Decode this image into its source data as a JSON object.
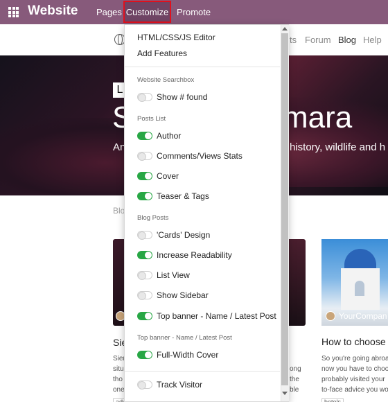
{
  "topbar": {
    "brand": "Website",
    "nav": {
      "pages": "Pages",
      "customize": "Customize",
      "promote": "Promote"
    }
  },
  "sitenav": {
    "items_partial": [
      "ts",
      "Forum",
      "Blog",
      "Help"
    ]
  },
  "hero": {
    "label_partial": "L",
    "title_left_partial": "S",
    "title_right_partial": "mara",
    "subtitle_left_partial": "An",
    "subtitle_right_partial": "history, wildlife and h"
  },
  "content": {
    "breadcrumb_partial": "Blo",
    "card1_title_partial": "Sie",
    "card1_lines": [
      "Sier",
      "situ",
      "tho",
      "one"
    ],
    "card2_lines": [
      "ong",
      "the",
      "ble"
    ],
    "card3_author_partial": "YourCompan",
    "card3_title_partial": "How to choose",
    "card3_lines": [
      "So you're going abroa",
      "now you have to choo",
      "probably visited your",
      "to-face advice you wo"
    ],
    "tags": [
      "adventure",
      "hotels",
      "hotels"
    ]
  },
  "dropdown": {
    "items": [
      "HTML/CSS/JS Editor",
      "Add Features"
    ],
    "sections": [
      {
        "header": "Website Searchbox",
        "options": [
          {
            "label": "Show # found",
            "on": false
          }
        ]
      },
      {
        "header": "Posts List",
        "options": [
          {
            "label": "Author",
            "on": true
          },
          {
            "label": "Comments/Views Stats",
            "on": false
          },
          {
            "label": "Cover",
            "on": true
          },
          {
            "label": "Teaser & Tags",
            "on": true
          }
        ]
      },
      {
        "header": "Blog Posts",
        "options": [
          {
            "label": "'Cards' Design",
            "on": false
          },
          {
            "label": "Increase Readability",
            "on": true
          },
          {
            "label": "List View",
            "on": false
          },
          {
            "label": "Show Sidebar",
            "on": false
          },
          {
            "label": "Top banner - Name / Latest Post",
            "on": true
          }
        ]
      },
      {
        "header": "Top banner - Name / Latest Post",
        "options": [
          {
            "label": "Full-Width Cover",
            "on": true
          }
        ]
      },
      {
        "header": "",
        "options": [
          {
            "label": "Track Visitor",
            "on": false
          }
        ]
      }
    ]
  },
  "colors": {
    "topbar": "#875a7b",
    "toggle_on": "#28a745",
    "highlight_border": "#e0101d"
  }
}
